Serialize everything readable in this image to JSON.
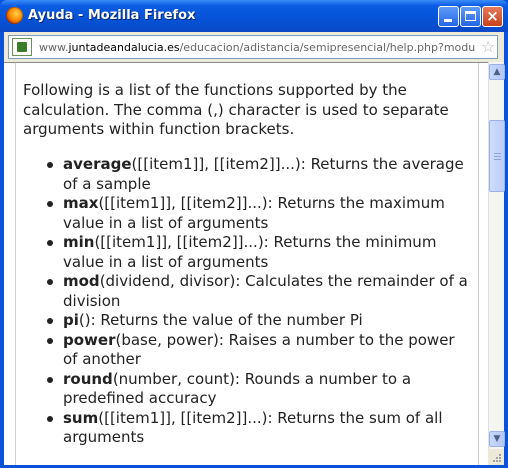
{
  "window": {
    "title": "Ayuda - Mozilla Firefox",
    "buttons": {
      "minimize": "minimize",
      "maximize": "maximize",
      "close": "×"
    }
  },
  "addressbar": {
    "url_prefix": "www.",
    "url_host": "juntadeandalucia.es",
    "url_path": "/educacion/adistancia/semipresencial/help.php?module=grade&",
    "star": "☆"
  },
  "page": {
    "intro": "Following is a list of the functions supported by the calculation. The comma (,) character is used to separate arguments within function brackets.",
    "functions": [
      {
        "name": "average",
        "description": "([[item1]], [[item2]]...): Returns the average of a sample"
      },
      {
        "name": "max",
        "description": "([[item1]], [[item2]]...): Returns the maximum value in a list of arguments"
      },
      {
        "name": "min",
        "description": "([[item1]], [[item2]]...): Returns the minimum value in a list of arguments"
      },
      {
        "name": "mod",
        "description": "(dividend, divisor): Calculates the remainder of a division"
      },
      {
        "name": "pi",
        "description": "(): Returns the value of the number Pi"
      },
      {
        "name": "power",
        "description": "(base, power): Raises a number to the power of another"
      },
      {
        "name": "round",
        "description": "(number, count): Rounds a number to a predefined accuracy"
      },
      {
        "name": "sum",
        "description": "([[item1]], [[item2]]...): Returns the sum of all arguments"
      }
    ]
  },
  "scrollbar": {
    "up_arrow": "▲",
    "down_arrow": "▼",
    "scroll_position": 0.14
  },
  "colors": {
    "title_bar": "#0552d6",
    "close_button": "#c6431b",
    "text": "#222222"
  }
}
